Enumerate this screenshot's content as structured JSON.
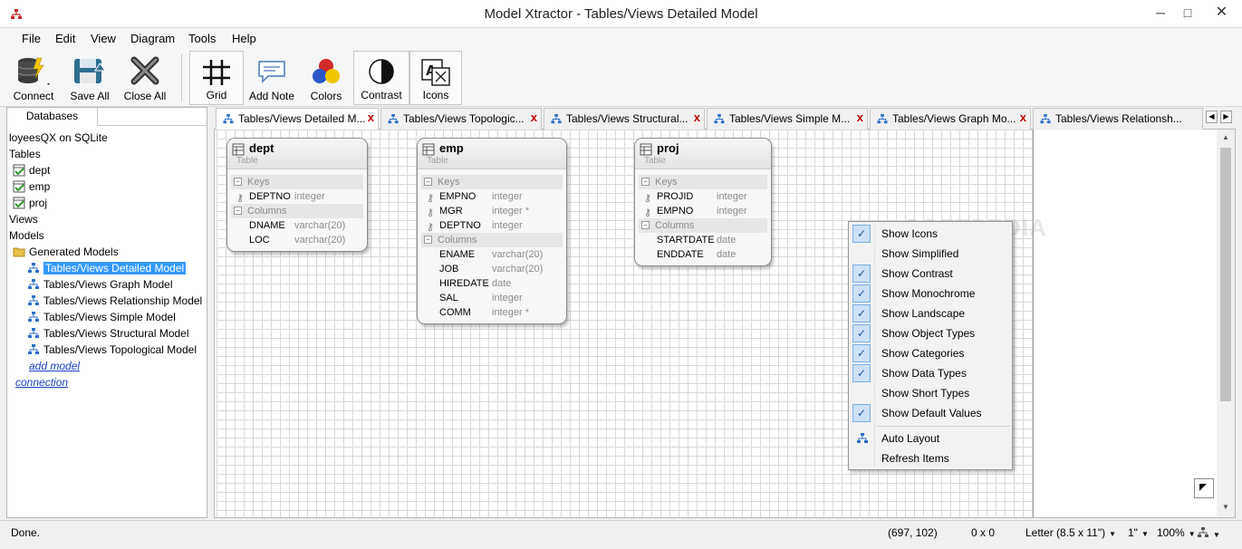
{
  "window": {
    "title": "Model Xtractor - Tables/Views Detailed Model",
    "minimize": "─",
    "maximize": "□",
    "close": "✕"
  },
  "menu": [
    "File",
    "Edit",
    "View",
    "Diagram",
    "Tools",
    "Help"
  ],
  "toolbar": {
    "connect": "Connect",
    "save_all": "Save All",
    "close_all": "Close All",
    "grid": "Grid",
    "add_note": "Add Note",
    "colors": "Colors",
    "contrast": "Contrast",
    "icons": "Icons"
  },
  "left_panel": {
    "tab": "Databases",
    "tree": [
      "loyeesQX on SQLite",
      "Tables",
      "dept",
      "emp",
      "proj",
      "Views",
      "Models",
      "Generated Models",
      "Tables/Views Detailed Model",
      "Tables/Views Graph Model",
      "Tables/Views Relationship Model",
      "Tables/Views Simple Model",
      "Tables/Views Structural Model",
      "Tables/Views Topological Model",
      "add model",
      "connection"
    ]
  },
  "tabs": [
    "Tables/Views Detailed M...",
    "Tables/Views Topologic...",
    "Tables/Views Structural...",
    "Tables/Views Simple M...",
    "Tables/Views Graph Mo...",
    "Tables/Views Relationsh..."
  ],
  "tab_close": "x",
  "entity_type_label": "Table",
  "section_labels": {
    "keys": "Keys",
    "columns": "Columns",
    "toggle": "−"
  },
  "entities": {
    "dept": {
      "name": "dept",
      "keys": [
        {
          "name": "DEPTNO",
          "type": "integer"
        }
      ],
      "columns": [
        {
          "name": "DNAME",
          "type": "varchar(20)"
        },
        {
          "name": "LOC",
          "type": "varchar(20)"
        }
      ]
    },
    "emp": {
      "name": "emp",
      "keys": [
        {
          "name": "EMPNO",
          "type": "integer"
        },
        {
          "name": "MGR",
          "type": "integer *"
        },
        {
          "name": "DEPTNO",
          "type": "integer"
        }
      ],
      "columns": [
        {
          "name": "ENAME",
          "type": "varchar(20)"
        },
        {
          "name": "JOB",
          "type": "varchar(20)"
        },
        {
          "name": "HIREDATE",
          "type": "date"
        },
        {
          "name": "SAL",
          "type": "integer"
        },
        {
          "name": "COMM",
          "type": "integer *"
        }
      ]
    },
    "proj": {
      "name": "proj",
      "keys": [
        {
          "name": "PROJID",
          "type": "integer"
        },
        {
          "name": "EMPNO",
          "type": "integer"
        }
      ],
      "columns": [
        {
          "name": "STARTDATE",
          "type": "date"
        },
        {
          "name": "ENDDATE",
          "type": "date"
        }
      ]
    }
  },
  "context_menu": {
    "check_mark": "✓",
    "items": [
      {
        "label": "Show Icons",
        "checked": true
      },
      {
        "label": "Show Simplified",
        "checked": false
      },
      {
        "label": "Show Contrast",
        "checked": true
      },
      {
        "label": "Show Monochrome",
        "checked": true
      },
      {
        "label": "Show Landscape",
        "checked": true
      },
      {
        "label": "Show Object Types",
        "checked": true
      },
      {
        "label": "Show Categories",
        "checked": true
      },
      {
        "label": "Show Data Types",
        "checked": true
      },
      {
        "label": "Show Short Types",
        "checked": false
      },
      {
        "label": "Show Default Values",
        "checked": true
      }
    ],
    "actions": [
      "Auto Layout",
      "Refresh Items"
    ]
  },
  "watermark": "SOFTPEDIA",
  "status": {
    "text": "Done.",
    "coords": "(697, 102)",
    "size": "0 x 0",
    "paper": "Letter (8.5 x 11\")",
    "margin": "1\"",
    "zoom": "100%",
    "dropdown_arrow": "▼"
  },
  "colors": {
    "selection": "#3399ff",
    "close_x": "#c00000",
    "link": "#1a3ec2"
  }
}
